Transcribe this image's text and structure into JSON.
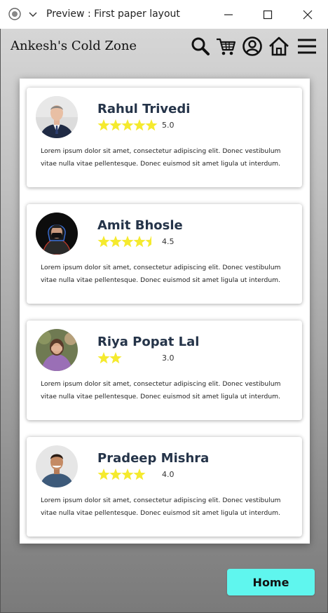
{
  "window": {
    "title": "Preview : First paper layout"
  },
  "header": {
    "brand": "Ankesh's Cold Zone",
    "icons": [
      "search-icon",
      "cart-icon",
      "user-icon",
      "home-icon",
      "menu-icon"
    ]
  },
  "reviews": [
    {
      "name": "Rahul Trivedi",
      "rating_text": "5.0",
      "rating": 5.0,
      "stars_shown": 5,
      "text": "Lorem ipsum dolor sit amet, consectetur adipiscing elit. Donec vestibulum vitae nulla vitae pellentesque. Donec euismod sit amet ligula ut interdum."
    },
    {
      "name": "Amit Bhosle",
      "rating_text": "4.5",
      "rating": 4.5,
      "stars_shown": 4.5,
      "text": "Lorem ipsum dolor sit amet, consectetur adipiscing elit. Donec vestibulum vitae nulla vitae pellentesque. Donec euismod sit amet ligula ut interdum."
    },
    {
      "name": "Riya Popat Lal",
      "rating_text": "3.0",
      "rating": 3.0,
      "stars_shown": 2,
      "text": "Lorem ipsum dolor sit amet, consectetur adipiscing elit. Donec vestibulum vitae nulla vitae pellentesque. Donec euismod sit amet ligula ut interdum."
    },
    {
      "name": "Pradeep Mishra",
      "rating_text": "4.0",
      "rating": 4.0,
      "stars_shown": 4,
      "text": "Lorem ipsum dolor sit amet, consectetur adipiscing elit. Donec vestibulum vitae nulla vitae pellentesque. Donec euismod sit amet ligula ut interdum."
    }
  ],
  "footer": {
    "home_label": "Home"
  },
  "colors": {
    "star": "#f5ea2e",
    "home_button": "#5ff6ee",
    "name_text": "#253449"
  }
}
